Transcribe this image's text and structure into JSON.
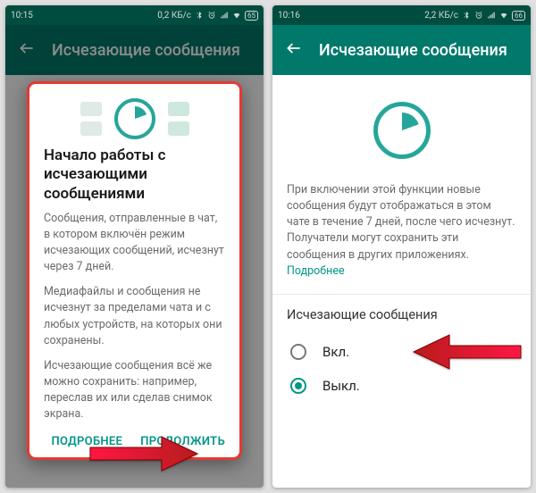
{
  "phone1": {
    "statusbar": {
      "time": "10:15",
      "net": "0,2 КБ/с",
      "battery": "65"
    },
    "appbar": {
      "title": "Исчезающие сообщения"
    },
    "dialog": {
      "title": "Начало работы с исчезающими сообщениями",
      "p1": "Сообщения, отправленные в чат, в котором включён режим исчезающих сообщений, исчезнут через 7 дней.",
      "p2": "Медиафайлы и сообщения не исчезнут за пределами чата и с любых устройств, на которых они сохранены.",
      "p3": "Исчезающие сообщения всё же можно сохранить: например, переслав их или сделав снимок экрана.",
      "more": "ПОДРОБНЕЕ",
      "continue": "ПРОДОЛЖИТЬ"
    }
  },
  "phone2": {
    "statusbar": {
      "time": "10:16",
      "net": "2,2 КБ/с",
      "battery": "66"
    },
    "appbar": {
      "title": "Исчезающие сообщения"
    },
    "body": {
      "desc": "При включении этой функции новые сообщения будут отображаться в этом чате в течение 7 дней, после чего исчезнут. Получатели могут сохранить эти сообщения в других приложениях.",
      "link": "Подробнее",
      "section": "Исчезающие сообщения",
      "opt_on": "Вкл.",
      "opt_off": "Выкл."
    }
  }
}
